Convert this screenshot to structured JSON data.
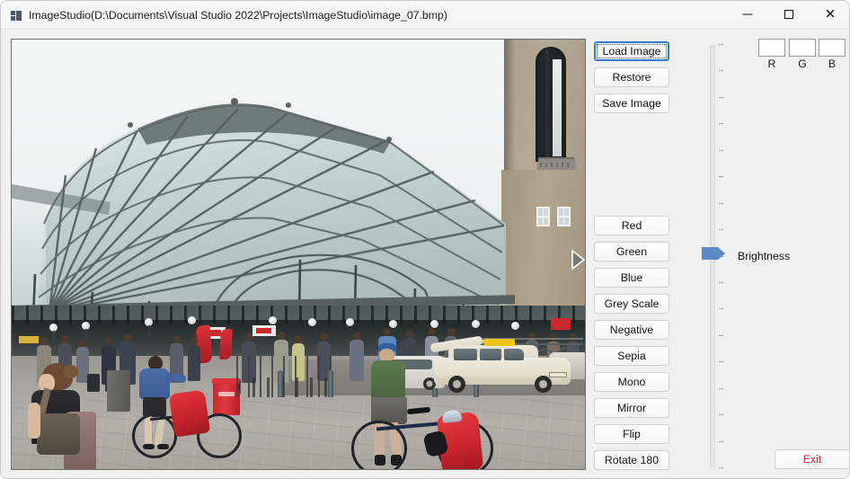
{
  "window": {
    "title": "ImageStudio(D:\\Documents\\Visual Studio 2022\\Projects\\ImageStudio\\image_07.bmp)",
    "app_icon": "app-window-icon",
    "controls": {
      "minimize": "─",
      "maximize": "□",
      "close": "✕"
    }
  },
  "file_buttons": [
    {
      "id": "load-image",
      "label": "Load Image",
      "focused": true
    },
    {
      "id": "restore",
      "label": "Restore",
      "focused": false
    },
    {
      "id": "save-image",
      "label": "Save Image",
      "focused": false
    }
  ],
  "filter_buttons": [
    {
      "id": "red",
      "label": "Red"
    },
    {
      "id": "green",
      "label": "Green"
    },
    {
      "id": "blue",
      "label": "Blue"
    },
    {
      "id": "grey-scale",
      "label": "Grey Scale"
    },
    {
      "id": "negative",
      "label": "Negative"
    },
    {
      "id": "sepia",
      "label": "Sepia"
    },
    {
      "id": "mono",
      "label": "Mono"
    },
    {
      "id": "mirror",
      "label": "Mirror"
    },
    {
      "id": "flip",
      "label": "Flip"
    },
    {
      "id": "rotate-180",
      "label": "Rotate 180"
    }
  ],
  "exit_button": {
    "label": "Exit",
    "color": "#e11b22"
  },
  "brightness": {
    "label": "Brightness",
    "orientation": "vertical",
    "thumb_position_percent": 48,
    "tick_count": 17,
    "thumb_color": "#5b8ac4"
  },
  "rgb": {
    "r": {
      "label": "R",
      "value": ""
    },
    "g": {
      "label": "G",
      "value": ""
    },
    "b": {
      "label": "B",
      "value": ""
    }
  },
  "picture": {
    "alt": "Photograph of a railway station forecourt with a large curved glass and steel canopy roof, a beige stone clock tower with a tall arched opening, pedestrians, parked bicycles, a red litter bin, a cream taxi with a yellow roof sign, and two touring cyclists with red panniers.",
    "next_arrow": "next-image-arrow"
  },
  "colors": {
    "form_background": "#f0f0f0",
    "title_bar": "#f6f6f6",
    "button_face": "#f6f6f6",
    "focus_blue": "#2f7fd1",
    "slider_blue": "#5b8ac4",
    "exit_red": "#e11b22",
    "picture_border": "#707070"
  }
}
